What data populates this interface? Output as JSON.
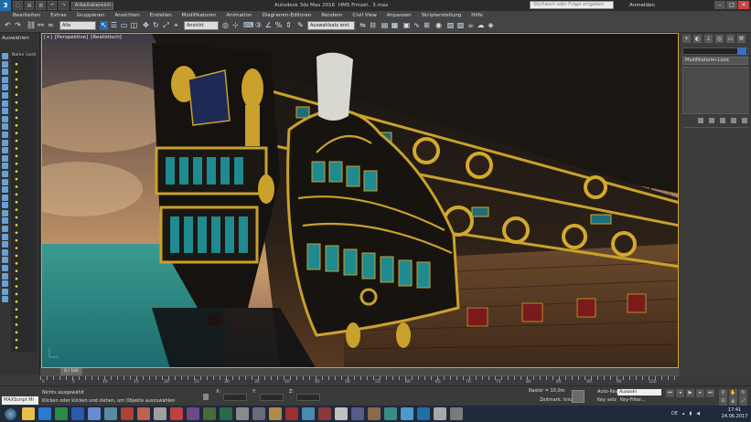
{
  "titlebar": {
    "workspace": "Arbeitsbereich: Vorga",
    "title": "Autodesk 3ds Max 2016",
    "file": "HMS Frinzel.. 3.max",
    "search_placeholder": "Stichwort oder Frage eingeben",
    "signin": "Anmelden",
    "minimize": "–",
    "maximize": "□",
    "close": "✕"
  },
  "menu": [
    "Bearbeiten",
    "Extras",
    "Gruppieren",
    "Ansichten",
    "Erstellen",
    "Modifikatoren",
    "Animation",
    "Diagramm-Editoren",
    "Rendern",
    "Civil View",
    "Anpassen",
    "Skripterstellung",
    "Hilfe"
  ],
  "toolbar": {
    "filter_select": "Alle",
    "refcoord_select": "Ansicht",
    "selection_set": "Auswahlsatz erst"
  },
  "leftpanel": {
    "header": "Auswählen",
    "col_header": "Name (sorti"
  },
  "viewport": {
    "labels": [
      "[+]",
      "[Perspektive]",
      "[Realistisch]"
    ]
  },
  "rightpanel": {
    "modifier_list": "Modifikatoren-Liste"
  },
  "timeline": {
    "slider": "0 / 100",
    "ruler": [
      "0",
      "5",
      "10",
      "15",
      "20",
      "25",
      "30",
      "35",
      "40",
      "45",
      "50",
      "55",
      "60",
      "65",
      "70",
      "75",
      "80",
      "85",
      "90",
      "95",
      "100"
    ]
  },
  "status": {
    "maxscript": "MAXScript Mi",
    "selection": "Nichts ausgewählt",
    "hint": "Klicken oder klicken und ziehen, um Objekte auszuwählen",
    "x_label": "X:",
    "y_label": "Y:",
    "z_label": "Z:",
    "grid": "Raster = 10,0m",
    "add_time": "Zeitmark. hinzuf.",
    "autokey": "Auto-Key",
    "autokey_value": "Auswahl",
    "setkey": "Key setz",
    "keyfilter": "Key-Filter..."
  },
  "taskbar": {
    "language": "DE",
    "time": "17:41",
    "date": "24.06.2017"
  },
  "colors": {
    "accent": "#2a6bb0",
    "viewport_border": "#d4a92a",
    "sky": "#6a5a60",
    "sea": "#1f7f80",
    "hull_gold": "#c9a12c"
  }
}
